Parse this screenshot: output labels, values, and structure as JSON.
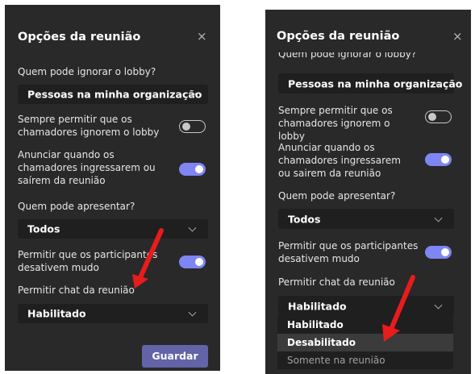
{
  "left_panel": {
    "title": "Opções da reunião",
    "close_icon": "×",
    "lobby_label": "Quem pode ignorar o lobby?",
    "lobby_value": "Pessoas na minha organização",
    "callers_bypass_label": "Sempre permitir que os chamadores ignorem o lobby",
    "callers_bypass_on": false,
    "announce_label": "Anunciar quando os chamadores ingressarem ou saírem da reunião",
    "announce_on": true,
    "presenter_label": "Quem pode apresentar?",
    "presenter_value": "Todos",
    "unmute_label": "Permitir que os participantes desativem mudo",
    "unmute_on": true,
    "chat_label": "Permitir chat da reunião",
    "chat_value": "Habilitado",
    "save_label": "Guardar"
  },
  "right_panel": {
    "title": "Opções da reunião",
    "close_icon": "×",
    "lobby_label": "Quem pode ignorar o lobby?",
    "lobby_value": "Pessoas na minha organização",
    "callers_bypass_label": "Sempre permitir que os chamadores ignorem o lobby",
    "callers_bypass_on": false,
    "announce_label": "Anunciar quando os chamadores ingressarem ou sairem da reunião",
    "announce_on": true,
    "presenter_label": "Quem pode apresentar?",
    "presenter_value": "Todos",
    "unmute_label": "Permitir que os participantes desativem mudo",
    "unmute_on": true,
    "chat_label": "Permitir chat da reunião",
    "chat_value": "Habilitado",
    "chat_options": [
      "Habilitado",
      "Desabilitado",
      "Somente na reunião"
    ],
    "highlighted_option": "Desabilitado"
  },
  "colors": {
    "panel_bg": "#292929",
    "dropdown_bg": "#1f1f1f",
    "toggle_on": "#7f85f5",
    "save_button": "#6264a7",
    "annotation_arrow": "#e81c1c"
  },
  "icons": {
    "close": "close-icon",
    "dropdown": "chevron-down-icon",
    "annotation": "red-arrow-icon"
  }
}
